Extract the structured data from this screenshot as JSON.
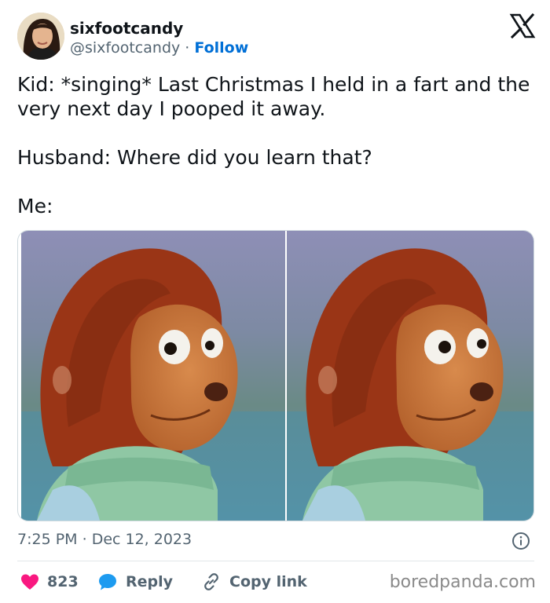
{
  "author": {
    "display_name": "sixfootcandy",
    "handle": "@sixfootcandy",
    "separator": " · ",
    "follow_label": "Follow"
  },
  "platform_icon": "x-logo-icon",
  "tweet": {
    "lines": [
      "Kid: *singing* Last Christmas I held in a fart and the very next day I pooped it away.",
      "Husband: Where did you learn that?",
      "Me:"
    ]
  },
  "media": {
    "description_icon": "puppet-meme-image"
  },
  "meta": {
    "time": "7:25 PM",
    "separator": " · ",
    "date": "Dec 12, 2023"
  },
  "actions": {
    "like_count": "823",
    "reply_label": "Reply",
    "copy_label": "Copy link"
  },
  "watermark": "boredpanda.com",
  "colors": {
    "like": "#f91880",
    "reply": "#1d9bf0",
    "follow": "#006fd6",
    "muted": "#536471"
  }
}
